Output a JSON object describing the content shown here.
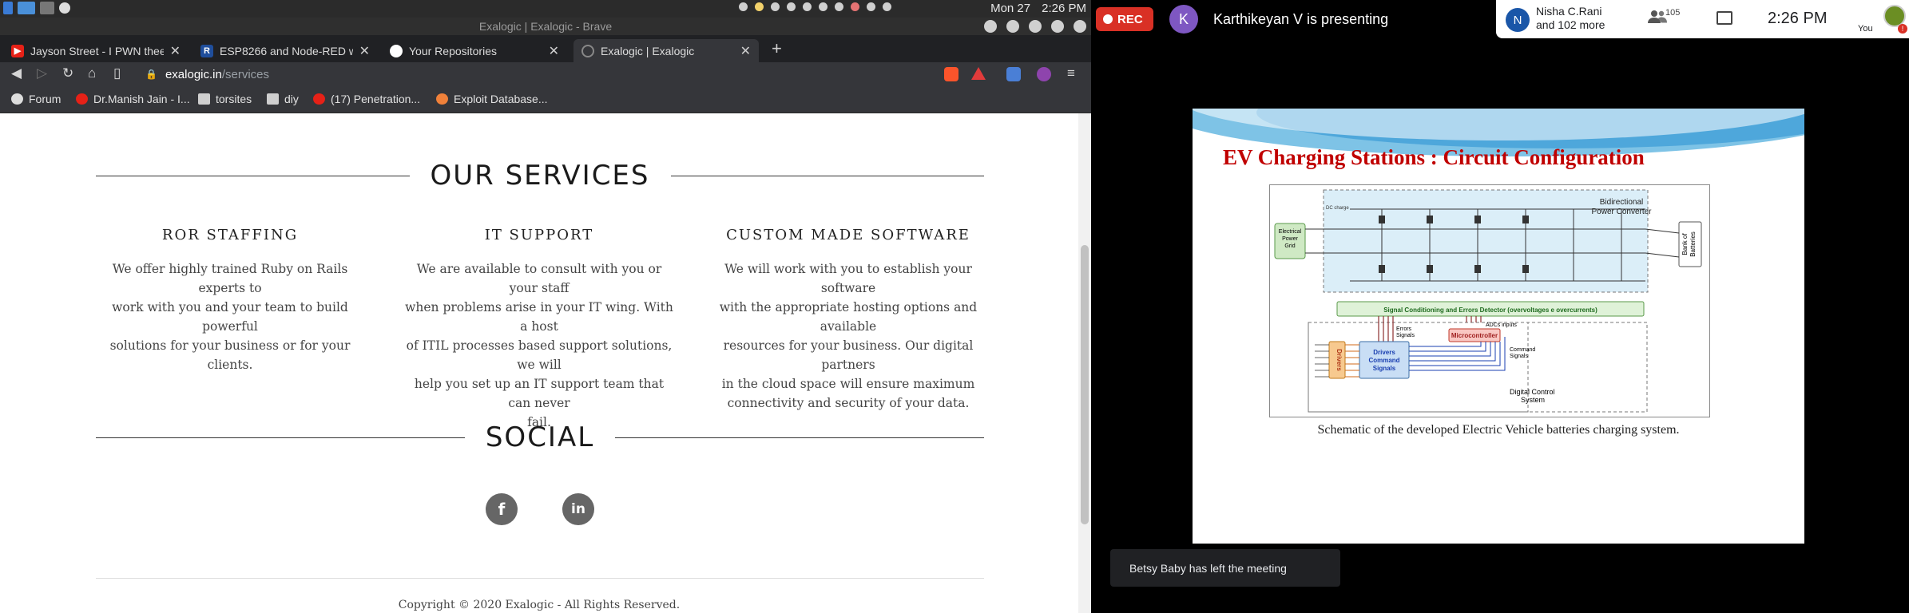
{
  "system": {
    "date": "Mon 27",
    "time": "2:26 PM"
  },
  "window": {
    "title": "Exalogic | Exalogic - Brave"
  },
  "tabs": [
    {
      "label": "Jayson Street - I PWN thee I PWN",
      "favicon_color": "#e62117"
    },
    {
      "label": "ESP8266 and Node-RED with MQTT",
      "favicon_color": "#1f4e9c",
      "favicon_text": "R"
    },
    {
      "label": "Your Repositories",
      "favicon_color": "#ffffff"
    },
    {
      "label": "Exalogic | Exalogic",
      "favicon_color": "#777777"
    }
  ],
  "address": {
    "host": "exalogic.in",
    "path": "/services"
  },
  "bookmarks": [
    {
      "label": "Forum",
      "icon": "globe-icon"
    },
    {
      "label": "Dr.Manish Jain - I...",
      "icon": "youtube-icon"
    },
    {
      "label": "torsites",
      "icon": "folder-icon"
    },
    {
      "label": "diy",
      "icon": "folder-icon"
    },
    {
      "label": "(17) Penetration...",
      "icon": "youtube-icon"
    },
    {
      "label": "Exploit Database...",
      "icon": "exploitdb-icon"
    }
  ],
  "page": {
    "services_heading": "OUR SERVICES",
    "services": [
      {
        "title": "ROR STAFFING",
        "lines": [
          "We offer highly trained Ruby on Rails experts to",
          "work with you and your team to build powerful",
          "solutions for your business or for your clients."
        ]
      },
      {
        "title": "IT SUPPORT",
        "lines": [
          "We are available to consult with you or your staff",
          "when problems arise in your IT wing. With a host",
          "of ITIL processes based support solutions, we will",
          "help you set up an IT support team that can never",
          "fail."
        ]
      },
      {
        "title": "CUSTOM MADE SOFTWARE",
        "lines": [
          "We will work with you to establish your software",
          "with the appropriate hosting options and available",
          "resources for your business.  Our digital partners",
          "in the cloud space will ensure maximum",
          "connectivity and security of your data."
        ]
      }
    ],
    "social_heading": "SOCIAL",
    "social_icons": [
      "facebook-icon",
      "linkedin-icon"
    ],
    "copyright": "Copyright © 2020 Exalogic - All Rights Reserved."
  },
  "meeting": {
    "rec_label": "REC",
    "presenter_initial": "K",
    "presenter_text": "Karthikeyan V is presenting",
    "participant_initial": "N",
    "participant_name": "Nisha C.Rani",
    "participant_more": "and 102 more",
    "people_count": "105",
    "time": "2:26 PM",
    "you_label": "You",
    "toast": "Betsy Baby has left the meeting"
  },
  "slide": {
    "title": "EV Charging Stations : Circuit Configuration",
    "caption": "Schematic of the developed Electric Vehicle batteries charging system.",
    "diagram": {
      "grid_label": [
        "Electrical",
        "Power",
        "Grid"
      ],
      "converter_label": [
        "Bidirectional",
        "Power Converter"
      ],
      "battery_label": [
        "Bank of",
        "Batteries"
      ],
      "dc_charge": "DC charge",
      "signal_box": "Signal Conditioning and Errors Detector (overvoltages e overcurrents)",
      "errors_signals": [
        "Errors",
        "Signals"
      ],
      "adcs_inputs": "ADCs inputs",
      "microcontroller": "Microcontroller",
      "drivers": "Drivers",
      "drivers_command": [
        "Drivers",
        "Command",
        "Signals"
      ],
      "command_signals": [
        "Command",
        "Signals"
      ],
      "digital_control": [
        "Digital Control",
        "System"
      ]
    }
  },
  "colors": {
    "rec": "#d93025",
    "presenter_avatar": "#7e57c2",
    "slide_title": "#c00000",
    "converter_fill": "#dbeef8",
    "signal_fill": "#dff2d8",
    "micro_fill": "#f9c7c2",
    "drivers_fill": "#f7c98f",
    "command_fill": "#c9def5"
  }
}
